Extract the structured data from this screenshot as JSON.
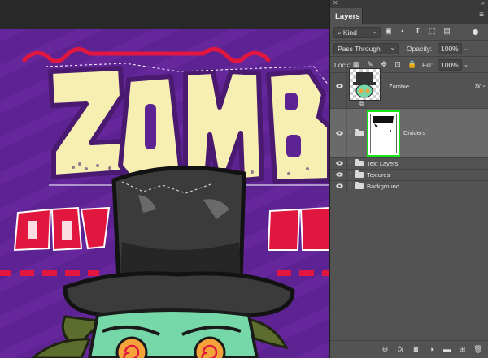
{
  "panel": {
    "tab_label": "Layers",
    "filter": {
      "kind_label": "Kind"
    },
    "blend_mode": "Pass Through",
    "opacity_label": "Opacity:",
    "opacity_value": "100%",
    "lock_label": "Lock:",
    "fill_label": "Fill:",
    "fill_value": "100%"
  },
  "layers": [
    {
      "name": "Zombie",
      "type": "layer",
      "has_fx": true
    },
    {
      "name": "Dividers",
      "type": "group-smart",
      "selected": true
    },
    {
      "name": "Text Layers",
      "type": "group"
    },
    {
      "name": "Textures",
      "type": "group"
    },
    {
      "name": "Background",
      "type": "group"
    }
  ],
  "artwork": {
    "title_text": "ZOMBI",
    "subtitle_left": "OUT",
    "subtitle_right": "BRE",
    "colors": {
      "background": "#5e2393",
      "title_fill": "#f6efb1",
      "title_outline": "#4a1a70",
      "red": "#e1173f",
      "hat": "#3b3b3b",
      "skin": "#76d7a8",
      "hair": "#5c6d2e",
      "eye": "#f6a23a"
    }
  },
  "icons": {
    "close": "close-icon",
    "collapse": "collapse-icon",
    "panel_menu": "panel-menu-icon"
  }
}
